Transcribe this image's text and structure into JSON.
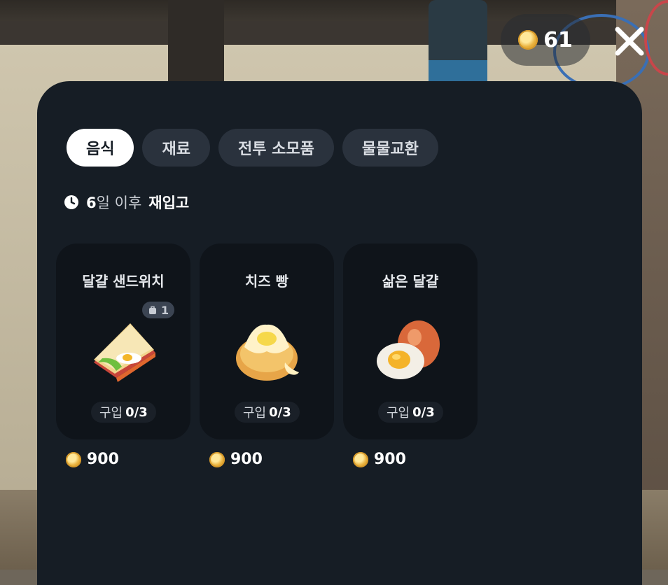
{
  "currency": {
    "amount": "61",
    "icon": "gold-coin-icon"
  },
  "close_icon": "close-icon",
  "tabs": [
    {
      "label": "음식",
      "active": true
    },
    {
      "label": "재료",
      "active": false
    },
    {
      "label": "전투 소모품",
      "active": false
    },
    {
      "label": "물물교환",
      "active": false
    }
  ],
  "restock": {
    "days": "6",
    "unit": "일 이후",
    "action": "재입고",
    "icon": "clock-icon"
  },
  "items": [
    {
      "name": "달걀 샌드위치",
      "owned": "1",
      "purchase_label": "구입",
      "purchase_count": "0/3",
      "price": "900",
      "icon": "sandwich-icon"
    },
    {
      "name": "치즈 빵",
      "purchase_label": "구입",
      "purchase_count": "0/3",
      "price": "900",
      "icon": "cheese-bread-icon"
    },
    {
      "name": "삶은 달걀",
      "purchase_label": "구입",
      "purchase_count": "0/3",
      "price": "900",
      "icon": "boiled-egg-icon"
    }
  ],
  "colors": {
    "panel": "#161d25",
    "card": "#0f141a",
    "tab_inactive": "#2a323d",
    "coin": "#e9b23e"
  }
}
